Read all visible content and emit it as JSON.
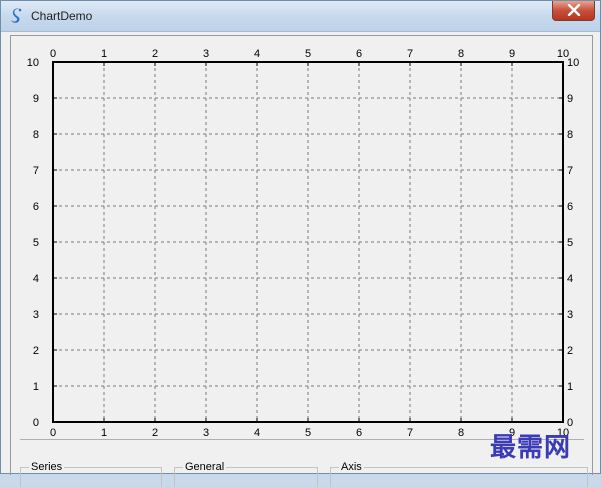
{
  "window": {
    "title": "ChartDemo"
  },
  "chart_data": {
    "type": "line",
    "series": [],
    "x_ticks": [
      "0",
      "1",
      "2",
      "3",
      "4",
      "5",
      "6",
      "7",
      "8",
      "9",
      "10"
    ],
    "y_ticks": [
      "0",
      "1",
      "2",
      "3",
      "4",
      "5",
      "6",
      "7",
      "8",
      "9",
      "10"
    ],
    "xlim": [
      0,
      10
    ],
    "ylim": [
      0,
      10
    ],
    "grid": true,
    "axes_labels_on": [
      "top",
      "bottom",
      "left",
      "right"
    ]
  },
  "groups": {
    "series_label": "Series",
    "general_label": "General",
    "axis_label": "Axis"
  },
  "watermark": "最需网"
}
